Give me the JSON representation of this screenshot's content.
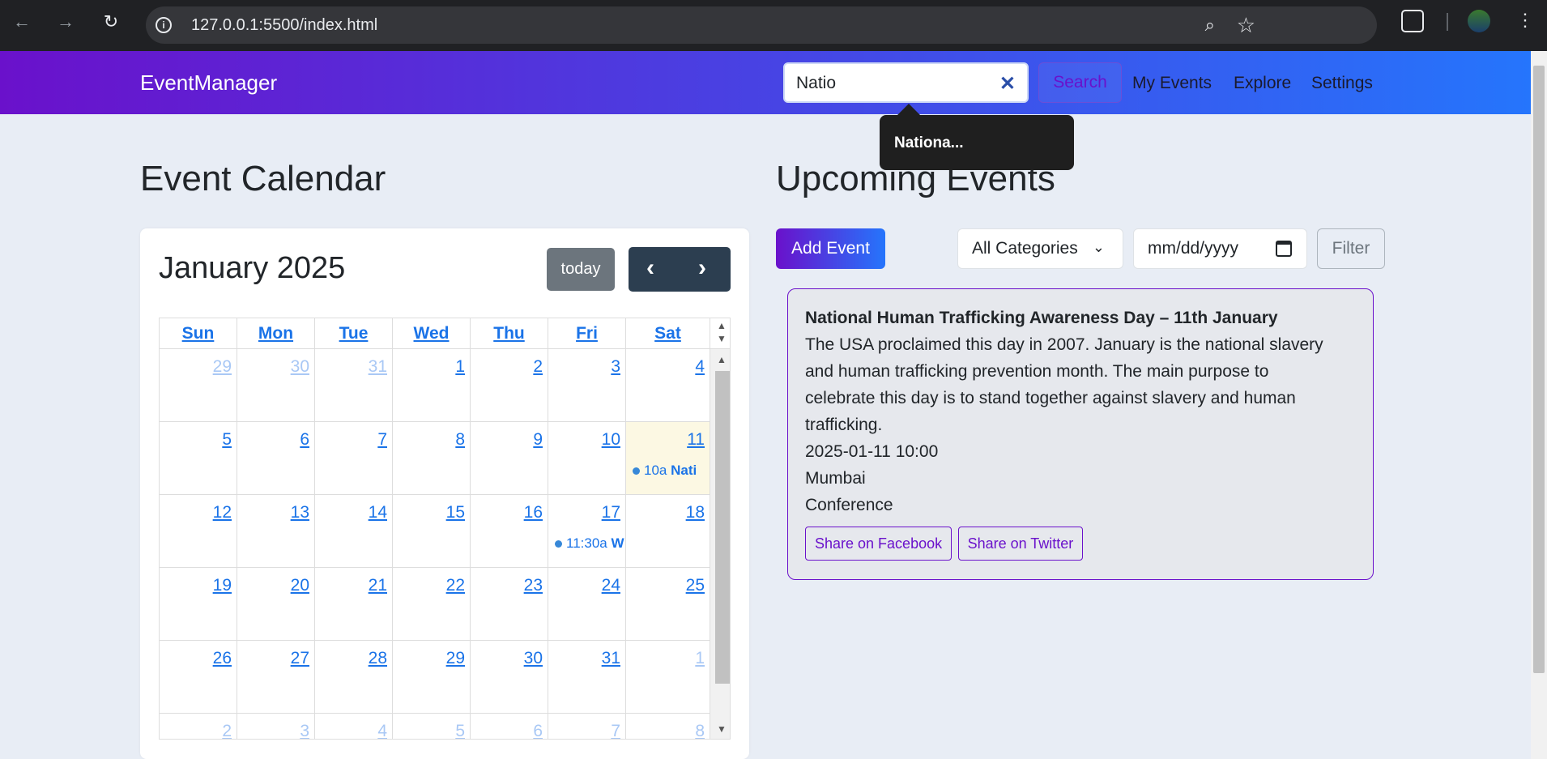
{
  "browser": {
    "url": "127.0.0.1:5500/index.html",
    "back_icon": "arrow-left-icon",
    "forward_icon": "arrow-right-icon",
    "reload_icon": "reload-icon"
  },
  "navbar": {
    "brand": "EventManager",
    "search_value": "Natio",
    "search_clear": "✕",
    "search_button": "Search",
    "links": [
      "My Events",
      "Explore",
      "Settings"
    ]
  },
  "tooltip": {
    "text": "Nationa..."
  },
  "calendar": {
    "heading": "Event Calendar",
    "title": "January 2025",
    "today_label": "today",
    "prev": "‹",
    "next": "›",
    "weekdays": [
      "Sun",
      "Mon",
      "Tue",
      "Wed",
      "Thu",
      "Fri",
      "Sat"
    ],
    "weeks": [
      [
        "29",
        "30",
        "31",
        "1",
        "2",
        "3",
        "4"
      ],
      [
        "5",
        "6",
        "7",
        "8",
        "9",
        "10",
        "11"
      ],
      [
        "12",
        "13",
        "14",
        "15",
        "16",
        "17",
        "18"
      ],
      [
        "19",
        "20",
        "21",
        "22",
        "23",
        "24",
        "25"
      ],
      [
        "26",
        "27",
        "28",
        "29",
        "30",
        "31",
        "1"
      ],
      [
        "2",
        "3",
        "4",
        "5",
        "6",
        "7",
        "8"
      ]
    ],
    "events": [
      {
        "time": "10a",
        "title": "Nati"
      },
      {
        "time": "11:30a",
        "title": "W"
      }
    ]
  },
  "upcoming": {
    "heading": "Upcoming Events",
    "add_button": "Add Event",
    "category_select": "All Categories",
    "date_placeholder": "mm/dd/yyyy",
    "filter_button": "Filter",
    "event": {
      "title": "National Human Trafficking Awareness Day – 11th January",
      "desc_lines": [
        "The USA proclaimed this day in 2007. January is the national slavery",
        "and human trafficking prevention month. The main purpose to",
        "celebrate this day is to stand together against slavery and human",
        "trafficking."
      ],
      "datetime": "2025-01-11 10:00",
      "location": "Mumbai",
      "category": "Conference",
      "share_facebook": "Share on Facebook",
      "share_twitter": "Share on Twitter"
    }
  }
}
